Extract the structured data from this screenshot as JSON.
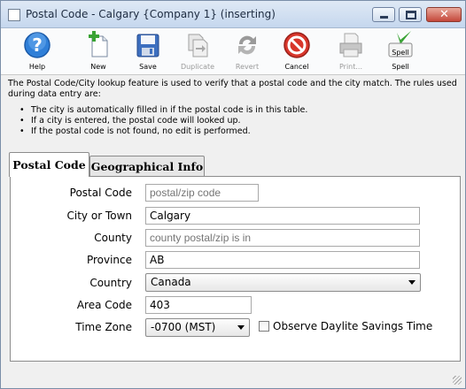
{
  "window": {
    "title": "Postal Code - Calgary {Company 1} (inserting)",
    "close_glyph": "✕"
  },
  "toolbar": {
    "buttons": [
      {
        "label": "Help",
        "icon": "help-icon",
        "enabled": true
      },
      {
        "label": "New",
        "icon": "new-document-icon",
        "enabled": true
      },
      {
        "label": "Save",
        "icon": "save-disk-icon",
        "enabled": true
      },
      {
        "label": "Duplicate",
        "icon": "duplicate-icon",
        "enabled": false
      },
      {
        "label": "Revert",
        "icon": "revert-icon",
        "enabled": false
      },
      {
        "label": "Cancel",
        "icon": "cancel-icon",
        "enabled": true
      },
      {
        "label": "Print...",
        "icon": "printer-icon",
        "enabled": false
      },
      {
        "label": "Spell",
        "icon": "spell-check-icon",
        "enabled": true,
        "badge": "Spell"
      }
    ]
  },
  "info": {
    "paragraph": "The Postal Code/City lookup feature is used to verify that a postal code and the city match.  The rules used during data entry are:",
    "bullets": [
      "The city is automatically filled in if the postal code is in this table.",
      "If a city is entered, the postal code will looked up.",
      "If the postal code is not found, no edit is performed."
    ]
  },
  "tabs": {
    "postal_code": "Postal Code",
    "geographical_info": "Geographical Info"
  },
  "form": {
    "postal_code": {
      "label": "Postal Code",
      "value": "",
      "placeholder": "postal/zip code"
    },
    "city": {
      "label": "City or Town",
      "value": "Calgary"
    },
    "county": {
      "label": "County",
      "value": "",
      "placeholder": "county postal/zip is in"
    },
    "province": {
      "label": "Province",
      "value": "AB"
    },
    "country": {
      "label": "Country",
      "value": "Canada"
    },
    "area_code": {
      "label": "Area Code",
      "value": "403"
    },
    "time_zone": {
      "label": "Time Zone",
      "value": "-0700 (MST)"
    },
    "daylight": {
      "label": "Observe Daylite Savings Time",
      "checked": false
    }
  },
  "colors": {
    "help_blue": "#2f7fd8",
    "new_green": "#3aa335",
    "save_blue": "#3d6fbf",
    "cancel_red": "#d8362b",
    "disabled_gray": "#9a9a9a"
  }
}
